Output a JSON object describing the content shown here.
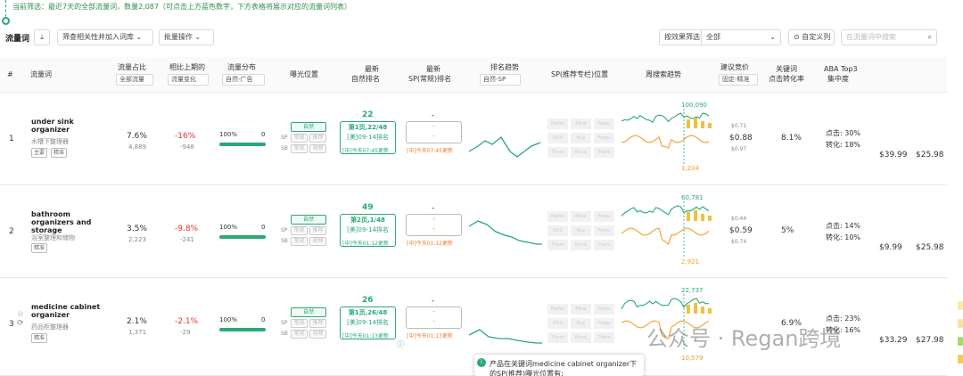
{
  "filter_text": "当前筛选：最近7天的全部流量词，数量2,087（可点击上方蓝色数字，下方表格将展示对应的流量词列表）",
  "toolbar": {
    "title": "流量词",
    "export_icon": "download-icon",
    "add_label": "筛查相关性并加入词库",
    "batch_label": "批量操作",
    "effect_label": "按效果筛选",
    "effect_value": "全部",
    "custom_label": "自定义列",
    "search_placeholder": "在流量词中搜索"
  },
  "header": {
    "idx": "#",
    "keyword": "流量词",
    "share": "流量占比",
    "share_sel": "全部流量",
    "prev": "相比上期的",
    "prev_sel": "流量变化",
    "dist": "流量分布",
    "dist_sel": "自然-广告",
    "expo": "曝光位置",
    "natural1": "最新",
    "natural2": "自然排名",
    "sp1": "最新",
    "sp2": "SP(常规)排名",
    "trend": "排名趋势",
    "trend_sel": "自然-SP",
    "sprec": "SP(推荐专栏)位置",
    "weekly": "周搜索趋势",
    "bid": "建议竞价",
    "bid_sel": "固定-精准",
    "cvr1": "关键词",
    "cvr2": "点击转化率",
    "aba1": "ABA Top3",
    "aba2": "集中度"
  },
  "rows": [
    {
      "idx": "1",
      "kw": "under sink organizer",
      "kw_cn": "水槽下整理器",
      "tags": [
        "主要",
        "精准"
      ],
      "share": "7.6%",
      "share_sub": "4,889",
      "prev": "-16%",
      "prev_sub": "-948",
      "dist_pct": "100%",
      "dist_r": "0",
      "dist_fill": 1,
      "rank": "22",
      "rank_page": "第1页,22/48",
      "rank_sub": "[美]09-14排名",
      "rank_upd": "[中]今天07:45更新",
      "sp": "-",
      "sp_upd": "[中]今天07:45更新",
      "peak": "100,090",
      "low": "1,204",
      "bid_hi": "$0.71",
      "bid": "$0.88",
      "bid_lo": "$0.97",
      "cvr": "8.1%",
      "aba_click": "点击: 30%",
      "aba_conv": "转化: 18%",
      "p1": "$39.99",
      "p2": "$25.98"
    },
    {
      "idx": "2",
      "kw": "bathroom organizers and storage",
      "kw_cn": "浴室整理和储物",
      "tags": [
        "精准"
      ],
      "share": "3.5%",
      "share_sub": "2,223",
      "prev": "-9.8%",
      "prev_sub": "-241",
      "dist_pct": "100%",
      "dist_r": "0",
      "dist_fill": 1,
      "rank": "49",
      "rank_page": "第2页,1/48",
      "rank_sub": "[美]09-14排名",
      "rank_upd": "[中]今天01:12更新",
      "sp": "-",
      "sp_upd": "[中]今天01:12更新",
      "peak": "60,781",
      "low": "2,921",
      "bid_hi": "$0.44",
      "bid": "$0.59",
      "bid_lo": "$0.74",
      "cvr": "5%",
      "aba_click": "点击: 14%",
      "aba_conv": "转化: 10%",
      "p1": "$9.99",
      "p2": "$25.98"
    },
    {
      "idx": "3",
      "kw": "medicine cabinet organizer",
      "kw_cn": "药品柜整理器",
      "tags": [
        "精准"
      ],
      "share": "2.1%",
      "share_sub": "1,371",
      "prev": "-2.1%",
      "prev_sub": "-29",
      "dist_pct": "100%",
      "dist_r": "0",
      "dist_fill": 1,
      "rank": "26",
      "rank_page": "第1页,26/48",
      "rank_sub": "[美]09-14排名",
      "rank_upd": "[中]今天01:13更新",
      "sp": "-",
      "sp_upd": "[中]今天01:13更新",
      "peak": "22,737",
      "low": "10,579",
      "bid_hi": "",
      "bid": "",
      "bid_lo": "",
      "cvr": "6.9%",
      "aba_click": "点击: 23%",
      "aba_conv": "转化: 16%",
      "p1": "$33.29",
      "p2": "$27.98"
    }
  ],
  "expo_labels": {
    "natural": "自然",
    "sp": "SP",
    "sb": "SB",
    "sp_a": "常规",
    "sp_b": "推荐",
    "sb_a": "常规",
    "sb_b": "视频"
  },
  "grid_labels": [
    "Marke",
    "4Star",
    "Frequ",
    "ROS",
    "Buy",
    "Frequ",
    "There",
    "Bund",
    "Them"
  ],
  "popup": "产品在关键词medicine cabinet organizer下的SP(推荐)曝光位置有:",
  "watermark": "公众号 · Regan跨境",
  "colors": {
    "green": "#2aa876",
    "orange": "#f0a030",
    "red": "#e3342f"
  }
}
